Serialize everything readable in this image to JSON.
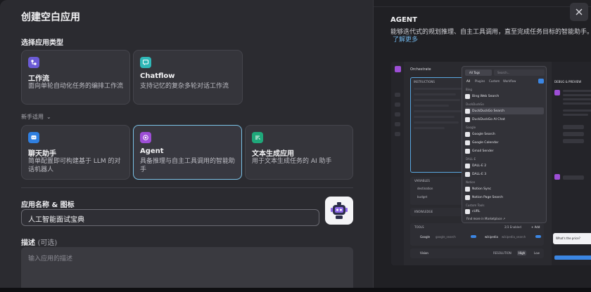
{
  "dialog": {
    "title": "创建空白应用",
    "app_type_label": "选择应用类型",
    "beginner_label": "新手适用",
    "name_icon_label": "应用名称 & 图标",
    "name_value": "人工智能面试宝典",
    "description_label": "描述",
    "description_optional": "(可选)",
    "description_placeholder": "输入应用的描述"
  },
  "app_types": [
    {
      "title": "工作流",
      "desc": "面向单轮自动化任务的编排工作流",
      "icon": "workflow-icon",
      "color": "#6b5bd6"
    },
    {
      "title": "Chatflow",
      "desc": "支持记忆的复杂多轮对话工作流",
      "icon": "chatflow-icon",
      "color": "#2fb7b7"
    }
  ],
  "beginner_types": [
    {
      "title": "聊天助手",
      "desc": "简单配置即可构建基于 LLM 的对话机器人",
      "icon": "chatbot-icon",
      "color": "#2f7fe0"
    },
    {
      "title": "Agent",
      "desc": "具备推理与自主工具调用的智能助手",
      "icon": "agent-icon",
      "color": "#9d4ed6",
      "selected": true
    },
    {
      "title": "文本生成应用",
      "desc": "用于文本生成任务的 AI 助手",
      "icon": "text-generator-icon",
      "color": "#1fa87a"
    }
  ],
  "preview_panel": {
    "title": "AGENT",
    "description": "能够迭代式的规划推理、自主工具调用，直至完成任务目标的智能助手。",
    "learn_more": "了解更多",
    "screenshot": {
      "orchestrate": "Orchestrate",
      "instructions": "INSTRUCTIONS",
      "debug_preview": "DEBUG & PREVIEW",
      "variables": "VARIABLES",
      "var_destination": "destination",
      "var_budget": "budget",
      "knowledge": "KNOWLEDGE",
      "tools": "TOOLS",
      "tools_enabled": "2/3 Enabled",
      "add": "+ Add",
      "tool_google": "Google",
      "tool_google_sub": "google_search",
      "tool_wikipedia": "wikipedia",
      "tool_wikipedia_sub": "wikipedia_search",
      "vision": "Vision",
      "resolution": "RESOLUTION",
      "high": "High",
      "low": "Low",
      "whats_price": "What's the price?",
      "dropdown": {
        "all_tags": "All Tags",
        "search": "Search...",
        "tabs": [
          "All",
          "Plugins",
          "Custom",
          "Workflow"
        ],
        "groups": [
          {
            "name": "Bing",
            "items": [
              "Bing Web Search"
            ]
          },
          {
            "name": "DuckDuckGo",
            "items": [
              "DuckDuckGo Search",
              "DuckDuckGo AI Chat"
            ]
          },
          {
            "name": "Google",
            "items": [
              "Google Search",
              "Google Calendar",
              "Gmail Sender"
            ]
          },
          {
            "name": "DALL-E",
            "items": [
              "DALL-E 2",
              "DALL-E 3"
            ]
          },
          {
            "name": "Notion",
            "items": [
              "Notion Sync",
              "Notion Page Search"
            ]
          },
          {
            "name": "Custom Tools",
            "items": [
              "cURL"
            ]
          }
        ],
        "find_more": "Find more in Marketplace ↗"
      }
    }
  },
  "close_icon": "close-icon"
}
